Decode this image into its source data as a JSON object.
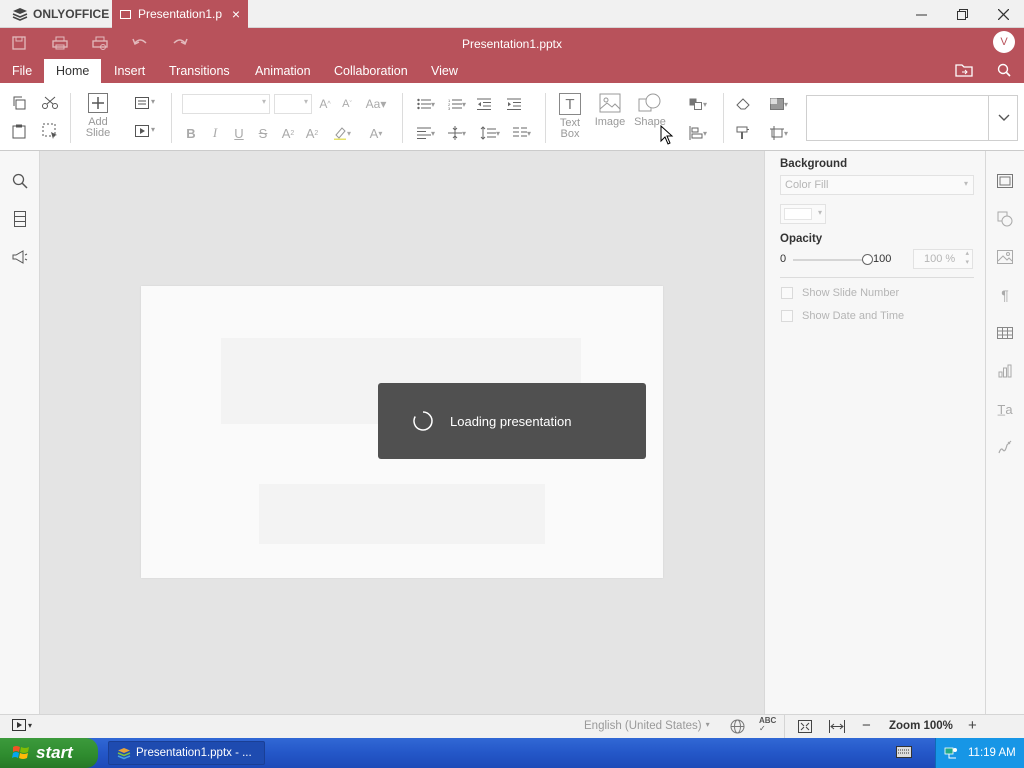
{
  "titlebar": {
    "app_name": "ONLYOFFICE",
    "tab_title": "Presentation1.pptx",
    "close_tab": "×"
  },
  "header": {
    "doc_title": "Presentation1.pptx",
    "avatar_initial": "V",
    "menu": [
      "File",
      "Home",
      "Insert",
      "Transitions",
      "Animation",
      "Collaboration",
      "View"
    ],
    "active_menu": "Home"
  },
  "toolbar": {
    "add_slide": "Add Slide",
    "text_box": "Text Box",
    "image": "Image",
    "shape": "Shape"
  },
  "loading": {
    "message": "Loading presentation"
  },
  "right_panel": {
    "background_label": "Background",
    "fill_type": "Color Fill",
    "opacity_label": "Opacity",
    "opacity_min": "0",
    "opacity_max": "100",
    "opacity_value": "100 %",
    "opacity_fraction": 1.0,
    "show_slide_number": "Show Slide Number",
    "show_date_time": "Show Date and Time"
  },
  "statusbar": {
    "language": "English (United States)",
    "zoom": "Zoom 100%",
    "zoom_out": "−",
    "zoom_in": "+"
  },
  "taskbar": {
    "start_label": "start",
    "task_label": "Presentation1.pptx - ...",
    "clock": "11:19 AM"
  },
  "colors": {
    "accent": "#b8525b",
    "taskbar_blue": "#245bd0",
    "start_green": "#2e8b2e"
  }
}
